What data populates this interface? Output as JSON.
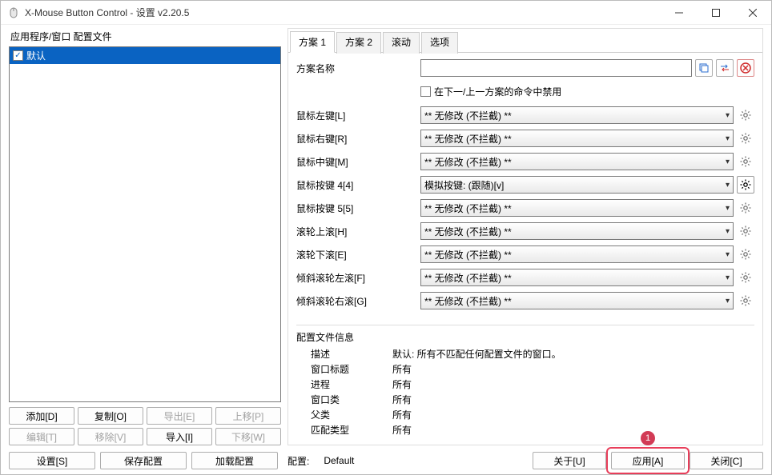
{
  "window": {
    "title": "X-Mouse Button Control - 设置 v2.20.5"
  },
  "sidebar": {
    "label": "应用程序/窗口 配置文件",
    "items": [
      {
        "label": "默认",
        "checked": true
      }
    ],
    "buttons": {
      "add": "添加[D]",
      "copy": "复制[O]",
      "export": "导出[E]",
      "moveup": "上移[P]",
      "edit": "编辑[T]",
      "remove": "移除[V]",
      "import": "导入[I]",
      "movedown": "下移[W]"
    }
  },
  "tabs": {
    "t1": "方案 1",
    "t2": "方案 2",
    "t3": "滚动",
    "t4": "选项"
  },
  "panel": {
    "name_label": "方案名称",
    "disable_label": "在下一/上一方案的命令中禁用",
    "rows": [
      {
        "label": "鼠标左键[L]",
        "value": "** 无修改 (不拦截) **",
        "gear": "normal"
      },
      {
        "label": "鼠标右键[R]",
        "value": "** 无修改 (不拦截) **",
        "gear": "normal"
      },
      {
        "label": "鼠标中键[M]",
        "value": "** 无修改 (不拦截) **",
        "gear": "normal"
      },
      {
        "label": "鼠标按键 4[4]",
        "value": "模拟按键: (跟随)[v]",
        "gear": "active"
      },
      {
        "label": "鼠标按键 5[5]",
        "value": "** 无修改 (不拦截) **",
        "gear": "normal"
      },
      {
        "label": "滚轮上滚[H]",
        "value": "** 无修改 (不拦截) **",
        "gear": "normal"
      },
      {
        "label": "滚轮下滚[E]",
        "value": "** 无修改 (不拦截) **",
        "gear": "normal"
      },
      {
        "label": "倾斜滚轮左滚[F]",
        "value": "** 无修改 (不拦截) **",
        "gear": "normal"
      },
      {
        "label": "倾斜滚轮右滚[G]",
        "value": "** 无修改 (不拦截) **",
        "gear": "normal"
      }
    ]
  },
  "info": {
    "title": "配置文件信息",
    "desc_label": "描述",
    "desc_value": "默认: 所有不匹配任何配置文件的窗口。",
    "rows": [
      {
        "label": "窗口标题",
        "value": "所有"
      },
      {
        "label": "进程",
        "value": "所有"
      },
      {
        "label": "窗口类",
        "value": "所有"
      },
      {
        "label": "父类",
        "value": "所有"
      },
      {
        "label": "匹配类型",
        "value": "所有"
      }
    ]
  },
  "footer": {
    "settings": "设置[S]",
    "save": "保存配置",
    "load": "加载配置",
    "config_label": "配置:",
    "config_value": "Default",
    "about": "关于[U]",
    "apply": "应用[A]",
    "close": "关闭[C]"
  },
  "annotation": {
    "badge": "1"
  }
}
